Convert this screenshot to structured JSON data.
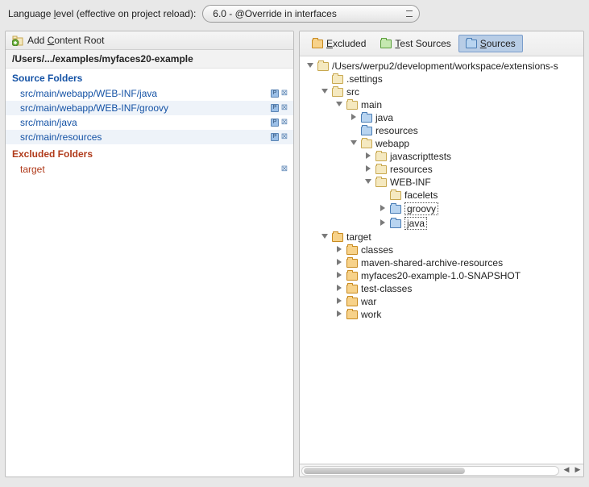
{
  "top": {
    "label_pre": "Language ",
    "label_u": "l",
    "label_post": "evel (effective on project reload):",
    "combo_value": "6.0 - @Override in interfaces"
  },
  "left": {
    "header_pre": "Add ",
    "header_u": "C",
    "header_post": "ontent Root",
    "path": "/Users/.../examples/myfaces20-example",
    "source_header": "Source Folders",
    "source_items": [
      "src/main/webapp/WEB-INF/java",
      "src/main/webapp/WEB-INF/groovy",
      "src/main/java",
      "src/main/resources"
    ],
    "excluded_header": "Excluded Folders",
    "excluded_items": [
      "target"
    ]
  },
  "tabs": {
    "excluded_u": "E",
    "excluded_post": "xcluded",
    "test_u": "T",
    "test_post": "est Sources",
    "sources_u": "S",
    "sources_post": "ources"
  },
  "tree": {
    "root": "/Users/werpu2/development/workspace/extensions-s",
    "settings": ".settings",
    "src": "src",
    "main": "main",
    "java": "java",
    "resources": "resources",
    "webapp": "webapp",
    "javascripttests": "javascripttests",
    "resources2": "resources",
    "webinf": "WEB-INF",
    "facelets": "facelets",
    "groovy": "groovy",
    "java2": "java",
    "target": "target",
    "classes": "classes",
    "mvn": "maven-shared-archive-resources",
    "snapshot": "myfaces20-example-1.0-SNAPSHOT",
    "testclasses": "test-classes",
    "war": "war",
    "work": "work"
  }
}
